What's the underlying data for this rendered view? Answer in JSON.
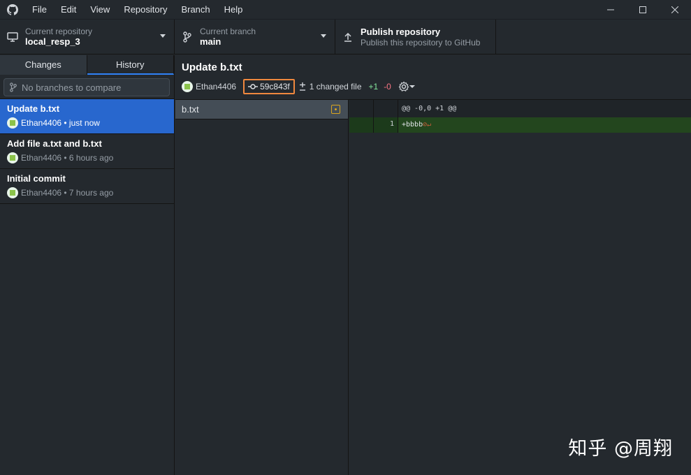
{
  "menu": [
    "File",
    "Edit",
    "View",
    "Repository",
    "Branch",
    "Help"
  ],
  "toolbar": {
    "repo_sub": "Current repository",
    "repo_main": "local_resp_3",
    "branch_sub": "Current branch",
    "branch_main": "main",
    "publish_main": "Publish repository",
    "publish_sub": "Publish this repository to GitHub"
  },
  "sidebar": {
    "tabs": [
      "Changes",
      "History"
    ],
    "compare_placeholder": "No branches to compare",
    "commits": [
      {
        "title": "Update b.txt",
        "meta": "Ethan4406 • just now"
      },
      {
        "title": "Add file a.txt and b.txt",
        "meta": "Ethan4406 • 6 hours ago"
      },
      {
        "title": "Initial commit",
        "meta": "Ethan4406 • 7 hours ago"
      }
    ]
  },
  "commit": {
    "title": "Update b.txt",
    "author": "Ethan4406",
    "sha": "59c843f",
    "changed": "1 changed file",
    "additions": "+1",
    "deletions": "-0"
  },
  "files": [
    {
      "name": "b.txt",
      "status": "modified"
    }
  ],
  "diff": {
    "hunk": "@@ -0,0 +1 @@",
    "line_number": "1",
    "line_text": "+bbbb",
    "nl_marker": "⊘↵"
  },
  "watermark": "知乎 @周翔",
  "colors": {
    "accent": "#2867ce",
    "sha_highlight": "#f0883e",
    "add": "#85e89d",
    "del": "#f97583"
  }
}
